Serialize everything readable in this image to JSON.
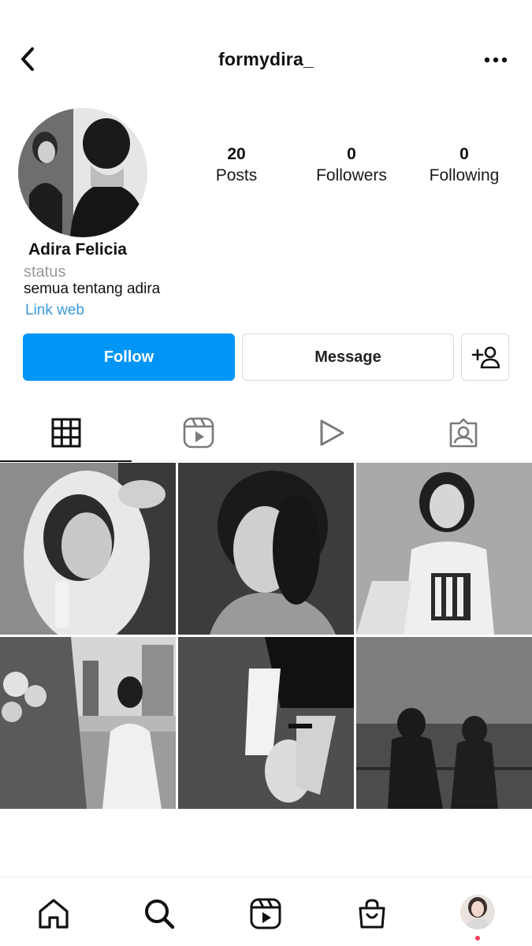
{
  "header": {
    "username": "formydira_"
  },
  "stats": {
    "posts": {
      "value": "20",
      "label": "Posts"
    },
    "followers": {
      "value": "0",
      "label": "Followers"
    },
    "following": {
      "value": "0",
      "label": "Following"
    }
  },
  "bio": {
    "name": "Adira Felicia",
    "status": "status",
    "text": "semua tentang adira",
    "link": "Link web"
  },
  "actions": {
    "follow_label": "Follow",
    "message_label": "Message"
  },
  "tabs": [
    {
      "icon": "grid-icon",
      "active": true
    },
    {
      "icon": "reels-icon",
      "active": false
    },
    {
      "icon": "video-play-icon",
      "active": false
    },
    {
      "icon": "tagged-icon",
      "active": false
    }
  ],
  "grid_posts": [
    "photo-mirror-portrait",
    "photo-closeup-portrait",
    "photo-sitting-graphic-shirt",
    "photo-flowers-city-dress",
    "photo-holding-hands",
    "photo-couple-silhouette-sea"
  ],
  "bottom_nav": [
    "home-icon",
    "search-icon",
    "reels-icon",
    "shop-icon",
    "profile-avatar"
  ],
  "colors": {
    "accent": "#0095f6",
    "link": "#3a9be0",
    "muted": "#9a9a9a",
    "notification_dot": "#ff3b5c"
  }
}
